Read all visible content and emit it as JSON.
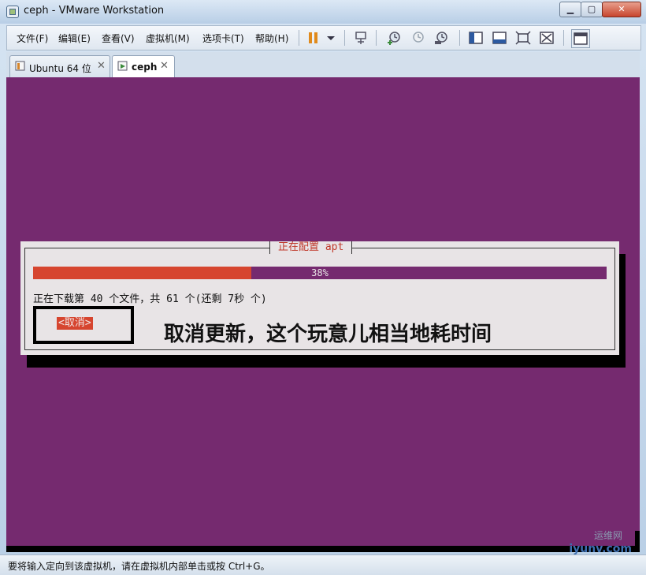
{
  "window": {
    "title": "ceph - VMware Workstation"
  },
  "menu": [
    "文件(F)",
    "编辑(E)",
    "查看(V)",
    "虚拟机(M)",
    "选项卡(T)",
    "帮助(H)"
  ],
  "tabs": [
    {
      "label": "Ubuntu 64 位",
      "active": false
    },
    {
      "label": "ceph",
      "active": true
    }
  ],
  "dialog": {
    "title": "正在配置 apt",
    "progress_percent": 38,
    "progress_text": "38%",
    "status": "正在下载第 40 个文件，共 61 个(还剩 7秒 个)",
    "cancel_label": "<取消>"
  },
  "annotation": "取消更新，这个玩意儿相当地耗时间",
  "statusbar": {
    "text": "要将输入定向到该虚拟机，请在虚拟机内部单击或按 Ctrl+G。"
  },
  "watermark": {
    "text": "iyunv.com",
    "sub": "运维网"
  },
  "colors": {
    "vm_bg": "#752a6f",
    "accent_red": "#d6452f",
    "dialog_bg": "#e8e4e6"
  }
}
